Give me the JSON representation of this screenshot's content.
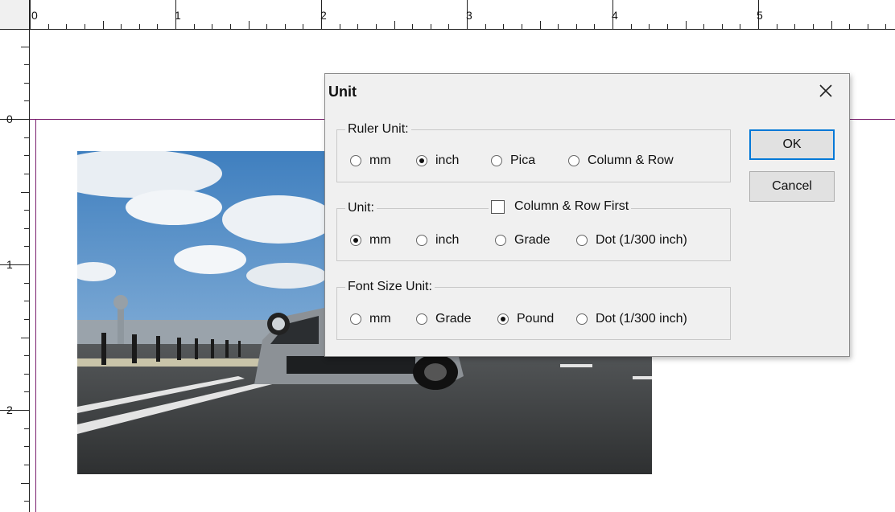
{
  "ruler": {
    "h_labels": [
      "0",
      "1",
      "2",
      "3",
      "4",
      "5"
    ],
    "v_labels": [
      "0",
      "1",
      "2"
    ]
  },
  "dialog": {
    "title": "Unit",
    "ruler_unit": {
      "legend": "Ruler Unit:",
      "options": [
        "mm",
        "inch",
        "Pica",
        "Column & Row"
      ],
      "selected": "inch"
    },
    "unit": {
      "legend": "Unit:",
      "checkbox_label": "Column & Row First",
      "checkbox_checked": false,
      "options": [
        "mm",
        "inch",
        "Grade",
        "Dot (1/300 inch)"
      ],
      "selected": "mm"
    },
    "font_size_unit": {
      "legend": "Font Size Unit:",
      "options": [
        "mm",
        "Grade",
        "Pound",
        "Dot (1/300 inch)"
      ],
      "selected": "Pound"
    },
    "ok_label": "OK",
    "cancel_label": "Cancel"
  },
  "colors": {
    "page_border": "#7a1f6e",
    "default_button_border": "#0078d7",
    "dialog_bg": "#f0f0f0"
  },
  "icons": {
    "close": "close-icon"
  }
}
